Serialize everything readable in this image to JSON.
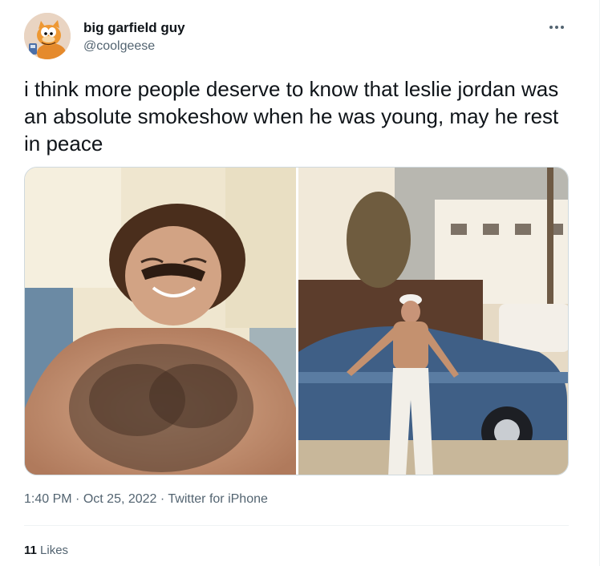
{
  "author": {
    "display_name": "big garfield guy",
    "handle": "@coolgeese",
    "avatar_icon": "garfield-avatar"
  },
  "tweet": {
    "text": "i think more people deserve to know that leslie jordan was an absolute smokeshow when he was young, may he rest in peace",
    "time": "1:40 PM",
    "separator": "·",
    "date": "Oct 25, 2022",
    "source": "Twitter for iPhone"
  },
  "stats": {
    "likes_count": "11",
    "likes_label": "Likes"
  },
  "icons": {
    "more": "more-options-icon"
  },
  "colors": {
    "text_primary": "#0f1419",
    "text_secondary": "#536471",
    "border": "#eff3f4"
  }
}
